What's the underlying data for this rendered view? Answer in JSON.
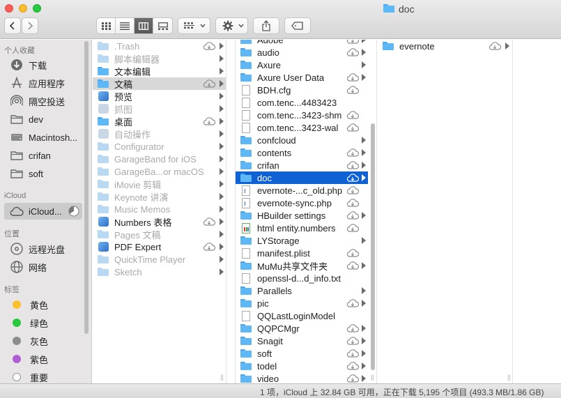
{
  "window": {
    "title": "doc",
    "status": "1 项，iCloud 上 32.84 GB 可用，正在下载 5,195 个项目 (493.3 MB/1.86 GB)"
  },
  "toolbar": {
    "back_icon": "chevron-left-icon",
    "forward_icon": "chevron-right-icon",
    "view_modes": [
      "icon-view",
      "list-view",
      "column-view",
      "gallery-view"
    ],
    "active_view": "column-view",
    "group_icon": "group-by-icon",
    "action_icon": "gear-icon",
    "share_icon": "share-icon",
    "tag_icon": "tag-icon"
  },
  "sidebar": {
    "favorites_label": "个人收藏",
    "favorites": [
      {
        "label": "下载",
        "icon": "download-icon"
      },
      {
        "label": "应用程序",
        "icon": "applications-icon"
      },
      {
        "label": "隔空投送",
        "icon": "airdrop-icon"
      },
      {
        "label": "dev",
        "icon": "folder-icon"
      },
      {
        "label": "Macintosh...",
        "icon": "hard-drive-icon"
      },
      {
        "label": "crifan",
        "icon": "folder-icon"
      },
      {
        "label": "soft",
        "icon": "folder-icon"
      }
    ],
    "icloud_label": "iCloud",
    "icloud": [
      {
        "label": "iCloud...",
        "icon": "cloud-icon"
      }
    ],
    "locations_label": "位置",
    "locations": [
      {
        "label": "远程光盘",
        "icon": "disc-icon"
      },
      {
        "label": "网络",
        "icon": "network-icon"
      }
    ],
    "tags_label": "标签",
    "tags": [
      {
        "label": "黄色",
        "color": "#fcc02e"
      },
      {
        "label": "绿色",
        "color": "#28c840"
      },
      {
        "label": "灰色",
        "color": "#8d8d8d"
      },
      {
        "label": "紫色",
        "color": "#b05ed4"
      },
      {
        "label": "重要",
        "color": "#ffffff"
      }
    ]
  },
  "column1": {
    "items": [
      {
        "name": ".Trash",
        "dim": true,
        "icon": "folder",
        "cloud": true,
        "arrow": true
      },
      {
        "name": "脚本编辑器",
        "dim": true,
        "icon": "folder",
        "cloud": false,
        "arrow": true
      },
      {
        "name": "文本编辑",
        "dim": false,
        "icon": "folder",
        "cloud": false,
        "arrow": true
      },
      {
        "name": "文稿",
        "dim": false,
        "icon": "folder",
        "cloud": true,
        "arrow": true,
        "selected": true
      },
      {
        "name": "预览",
        "dim": false,
        "icon": "app",
        "cloud": false,
        "arrow": true
      },
      {
        "name": "抓图",
        "dim": true,
        "icon": "app",
        "cloud": false,
        "arrow": true
      },
      {
        "name": "桌面",
        "dim": false,
        "icon": "folder",
        "cloud": true,
        "arrow": true
      },
      {
        "name": "自动操作",
        "dim": true,
        "icon": "app",
        "cloud": false,
        "arrow": true
      },
      {
        "name": "Configurator",
        "dim": true,
        "icon": "folder",
        "cloud": false,
        "arrow": true
      },
      {
        "name": "GarageBand for iOS",
        "dim": true,
        "icon": "folder",
        "cloud": false,
        "arrow": true
      },
      {
        "name": "GarageBa...or macOS",
        "dim": true,
        "icon": "folder",
        "cloud": false,
        "arrow": true
      },
      {
        "name": "iMovie 剪辑",
        "dim": true,
        "icon": "folder",
        "cloud": false,
        "arrow": true
      },
      {
        "name": "Keynote 讲演",
        "dim": true,
        "icon": "folder",
        "cloud": false,
        "arrow": true
      },
      {
        "name": "Music Memos",
        "dim": true,
        "icon": "folder",
        "cloud": false,
        "arrow": true
      },
      {
        "name": "Numbers 表格",
        "dim": false,
        "icon": "app",
        "cloud": true,
        "arrow": true
      },
      {
        "name": "Pages 文稿",
        "dim": true,
        "icon": "folder",
        "cloud": false,
        "arrow": true
      },
      {
        "name": "PDF Expert",
        "dim": false,
        "icon": "app",
        "cloud": true,
        "arrow": true
      },
      {
        "name": "QuickTime Player",
        "dim": true,
        "icon": "folder",
        "cloud": false,
        "arrow": true
      },
      {
        "name": "Sketch",
        "dim": true,
        "icon": "folder",
        "cloud": false,
        "arrow": true
      }
    ]
  },
  "column2": {
    "items": [
      {
        "name": "Adobe",
        "icon": "folder",
        "cloud": true,
        "arrow": true
      },
      {
        "name": "audio",
        "icon": "folder",
        "cloud": true,
        "arrow": true
      },
      {
        "name": "Axure",
        "icon": "folder",
        "cloud": false,
        "arrow": true
      },
      {
        "name": "Axure User Data",
        "icon": "folder",
        "cloud": true,
        "arrow": true
      },
      {
        "name": "BDH.cfg",
        "icon": "doc",
        "cloud": true,
        "arrow": false
      },
      {
        "name": "com.tenc...4483423",
        "icon": "doc",
        "cloud": false,
        "arrow": false
      },
      {
        "name": "com.tenc...3423-shm",
        "icon": "doc",
        "cloud": true,
        "arrow": false
      },
      {
        "name": "com.tenc...3423-wal",
        "icon": "doc",
        "cloud": true,
        "arrow": false
      },
      {
        "name": "confcloud",
        "icon": "folder",
        "cloud": false,
        "arrow": true
      },
      {
        "name": "contents",
        "icon": "folder",
        "cloud": true,
        "arrow": true
      },
      {
        "name": "crifan",
        "icon": "folder",
        "cloud": true,
        "arrow": true
      },
      {
        "name": "doc",
        "icon": "folder",
        "cloud": true,
        "arrow": true,
        "selected": true
      },
      {
        "name": "evernote-...c_old.php",
        "icon": "php",
        "cloud": true,
        "arrow": false
      },
      {
        "name": "evernote-sync.php",
        "icon": "php",
        "cloud": true,
        "arrow": false
      },
      {
        "name": "HBuilder settings",
        "icon": "folder",
        "cloud": true,
        "arrow": true
      },
      {
        "name": "html entity.numbers",
        "icon": "numbers",
        "cloud": true,
        "arrow": false
      },
      {
        "name": "LYStorage",
        "icon": "folder",
        "cloud": false,
        "arrow": true
      },
      {
        "name": "manifest.plist",
        "icon": "doc",
        "cloud": true,
        "arrow": false
      },
      {
        "name": "MuMu共享文件夹",
        "icon": "folder",
        "cloud": true,
        "arrow": true
      },
      {
        "name": "openssl-d...d_info.txt",
        "icon": "doc",
        "cloud": false,
        "arrow": false
      },
      {
        "name": "Parallels",
        "icon": "folder",
        "cloud": false,
        "arrow": true
      },
      {
        "name": "pic",
        "icon": "folder",
        "cloud": true,
        "arrow": true
      },
      {
        "name": "QQLastLoginModel",
        "icon": "doc",
        "cloud": false,
        "arrow": false
      },
      {
        "name": "QQPCMgr",
        "icon": "folder",
        "cloud": true,
        "arrow": true
      },
      {
        "name": "Snagit",
        "icon": "folder",
        "cloud": true,
        "arrow": true
      },
      {
        "name": "soft",
        "icon": "folder",
        "cloud": true,
        "arrow": true
      },
      {
        "name": "todel",
        "icon": "folder",
        "cloud": true,
        "arrow": true
      },
      {
        "name": "video",
        "icon": "folder",
        "cloud": true,
        "arrow": true
      }
    ]
  },
  "column3": {
    "items": [
      {
        "name": "evernote",
        "icon": "folder",
        "cloud": true,
        "arrow": true
      }
    ]
  },
  "colors": {
    "selection": "#0f61d4",
    "folder_blue": "#5fb8f6",
    "sidebar_bg": "#e7e5e6"
  }
}
